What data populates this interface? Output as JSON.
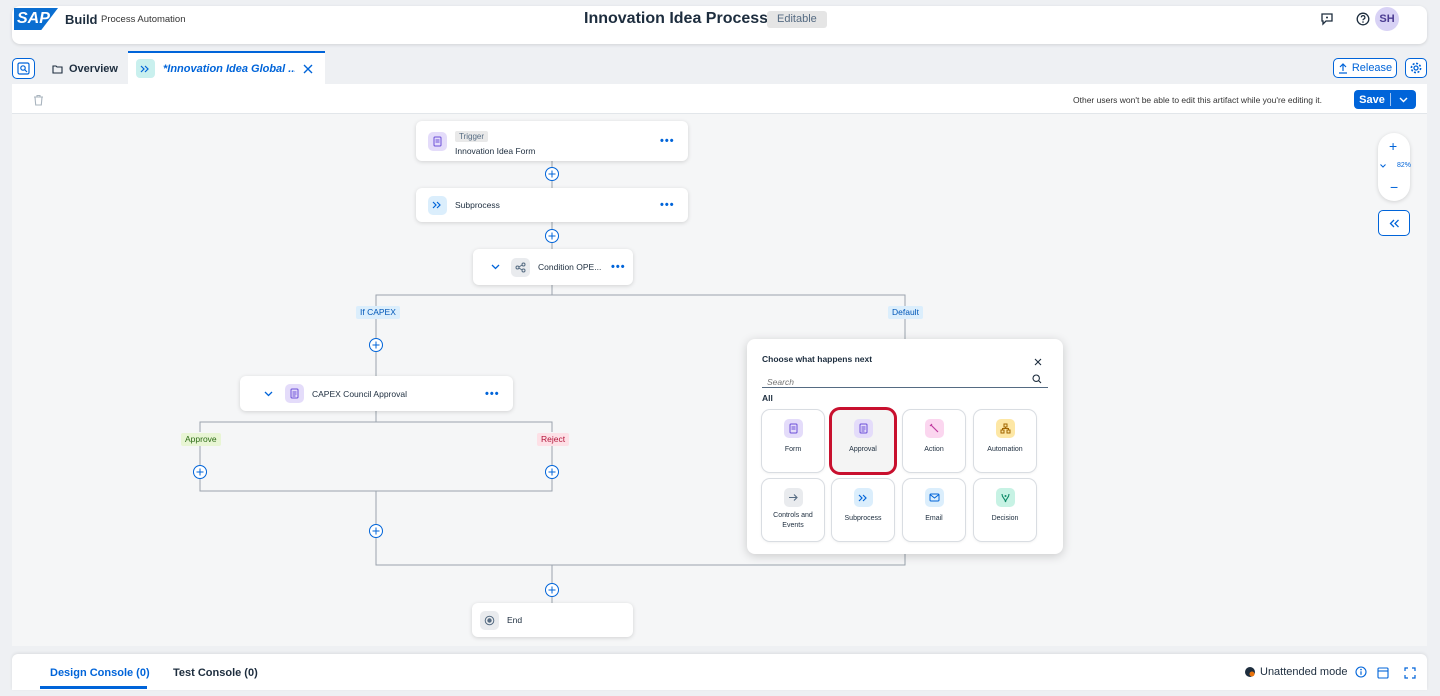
{
  "shell": {
    "brand": "Build",
    "brand_sub": "Process Automation",
    "title": "Innovation Idea Process",
    "status_badge": "Editable",
    "avatar_initials": "SH"
  },
  "tabs": {
    "overview_label": "Overview",
    "active_label": "*Innovation Idea Global ...",
    "release_label": "Release"
  },
  "toolbar": {
    "note": "Other users won't be able to edit this artifact while you're editing it.",
    "save_label": "Save"
  },
  "flow": {
    "trigger_tag": "Trigger",
    "trigger_name": "Innovation Idea Form",
    "subprocess_name": "Subprocess",
    "condition_name": "Condition OPE...",
    "branch_capex": "If CAPEX",
    "branch_default": "Default",
    "approval_name": "CAPEX Council Approval",
    "branch_approve": "Approve",
    "branch_reject": "Reject",
    "end_name": "End"
  },
  "zoom": {
    "level": "82%"
  },
  "popover": {
    "title": "Choose what happens next",
    "search_placeholder": "Search",
    "section": "All",
    "tiles": [
      {
        "label": "Form",
        "icon": "form-icon"
      },
      {
        "label": "Approval",
        "icon": "approval-icon"
      },
      {
        "label": "Action",
        "icon": "action-icon"
      },
      {
        "label": "Automation",
        "icon": "automation-icon"
      },
      {
        "label": "Controls and Events",
        "icon": "controls-icon"
      },
      {
        "label": "Subprocess",
        "icon": "subprocess-icon"
      },
      {
        "label": "Email",
        "icon": "email-icon"
      },
      {
        "label": "Decision",
        "icon": "decision-icon"
      }
    ],
    "selected": "Approval"
  },
  "console": {
    "design_tab": "Design Console (0)",
    "test_tab": "Test Console (0)",
    "mode_label": "Unattended mode"
  },
  "colors": {
    "accent": "#0064d9",
    "approve_bg": "#e8f5d4",
    "reject_bg": "#fde0e6",
    "branch_bg": "#dbeefc",
    "selection": "#c8102e"
  }
}
